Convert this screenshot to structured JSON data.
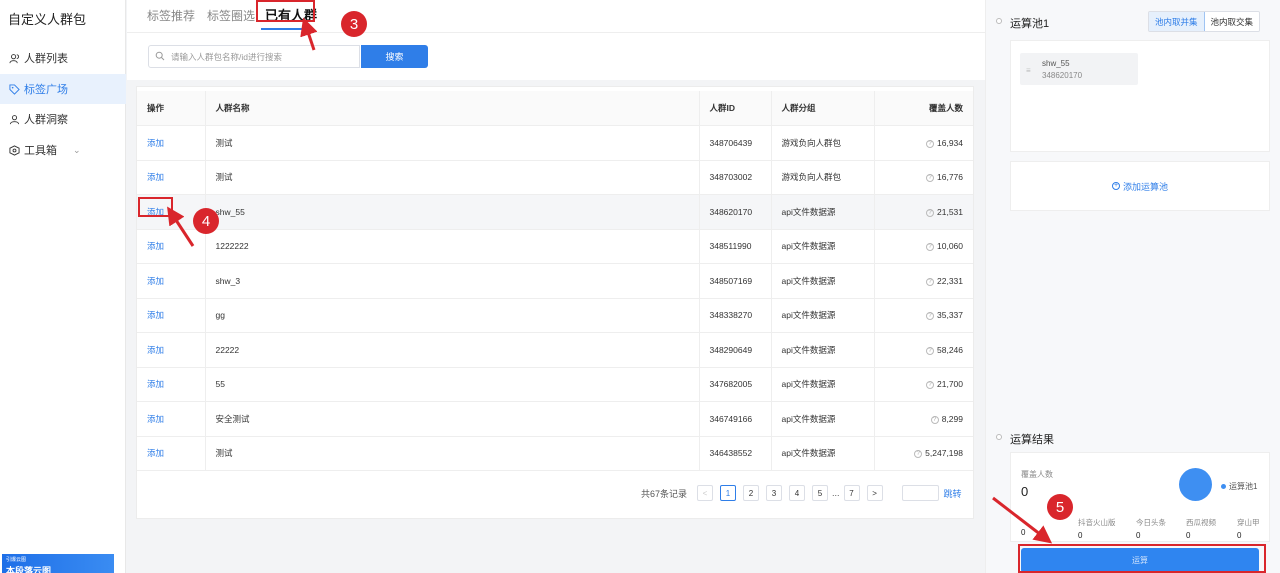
{
  "app": {
    "title": "自定义人群包"
  },
  "sidebar": {
    "items": [
      {
        "label": "人群列表",
        "icon": "users-icon"
      },
      {
        "label": "标签广场",
        "icon": "tag-icon"
      },
      {
        "label": "人群洞察",
        "icon": "user-insight-icon"
      },
      {
        "label": "工具箱",
        "icon": "toolbox-icon"
      }
    ],
    "promo": {
      "small": "引爆云图",
      "big": "本段落云图"
    }
  },
  "tabs": [
    {
      "label": "标签推荐"
    },
    {
      "label": "标签圈选"
    },
    {
      "label": "已有人群"
    }
  ],
  "search": {
    "placeholder": "请输入人群包名称/id进行搜索",
    "button": "搜索"
  },
  "table": {
    "headers": [
      "操作",
      "人群名称",
      "人群ID",
      "人群分组",
      "覆盖人数"
    ],
    "rows": [
      {
        "action": "添加",
        "name": "测试",
        "id": "348706439",
        "group": "游戏负向人群包",
        "count": "16,934"
      },
      {
        "action": "添加",
        "name": "测试",
        "id": "348703002",
        "group": "游戏负向人群包",
        "count": "16,776"
      },
      {
        "action": "添加",
        "name": "shw_55",
        "id": "348620170",
        "group": "api文件数据源",
        "count": "21,531"
      },
      {
        "action": "添加",
        "name": "1222222",
        "id": "348511990",
        "group": "api文件数据源",
        "count": "10,060"
      },
      {
        "action": "添加",
        "name": "shw_3",
        "id": "348507169",
        "group": "api文件数据源",
        "count": "22,331"
      },
      {
        "action": "添加",
        "name": "gg",
        "id": "348338270",
        "group": "api文件数据源",
        "count": "35,337"
      },
      {
        "action": "添加",
        "name": "22222",
        "id": "348290649",
        "group": "api文件数据源",
        "count": "58,246"
      },
      {
        "action": "添加",
        "name": "55",
        "id": "347682005",
        "group": "api文件数据源",
        "count": "21,700"
      },
      {
        "action": "添加",
        "name": "安全测试",
        "id": "346749166",
        "group": "api文件数据源",
        "count": "8,299"
      },
      {
        "action": "添加",
        "name": "测试",
        "id": "346438552",
        "group": "api文件数据源",
        "count": "5,247,198"
      }
    ]
  },
  "pagination": {
    "total": "共67条记录",
    "prev": "<",
    "pages": [
      "1",
      "2",
      "3",
      "4",
      "5"
    ],
    "ellipsis": "...",
    "last": "7",
    "next": ">",
    "current": "1",
    "jump": "跳转"
  },
  "right": {
    "pool_title": "运算池1",
    "modes": [
      "池内取并集",
      "池内取交集"
    ],
    "pool_item": {
      "name": "shw_55",
      "id": "348620170"
    },
    "add_pool": "添加运算池",
    "result_title": "运算结果",
    "coverage_label": "覆盖人数",
    "coverage_value": "0",
    "legend": "运算池1",
    "media": [
      {
        "name": "抖音火山版",
        "value": "0"
      },
      {
        "name": "今日头条",
        "value": "0"
      },
      {
        "name": "西瓜视频",
        "value": "0"
      },
      {
        "name": "穿山甲",
        "value": "0"
      }
    ],
    "first_media_value": "0",
    "compute_button": "运算"
  },
  "annotations": {
    "b3": "3",
    "b4": "4",
    "b5": "5",
    "color": "#d9262c"
  }
}
